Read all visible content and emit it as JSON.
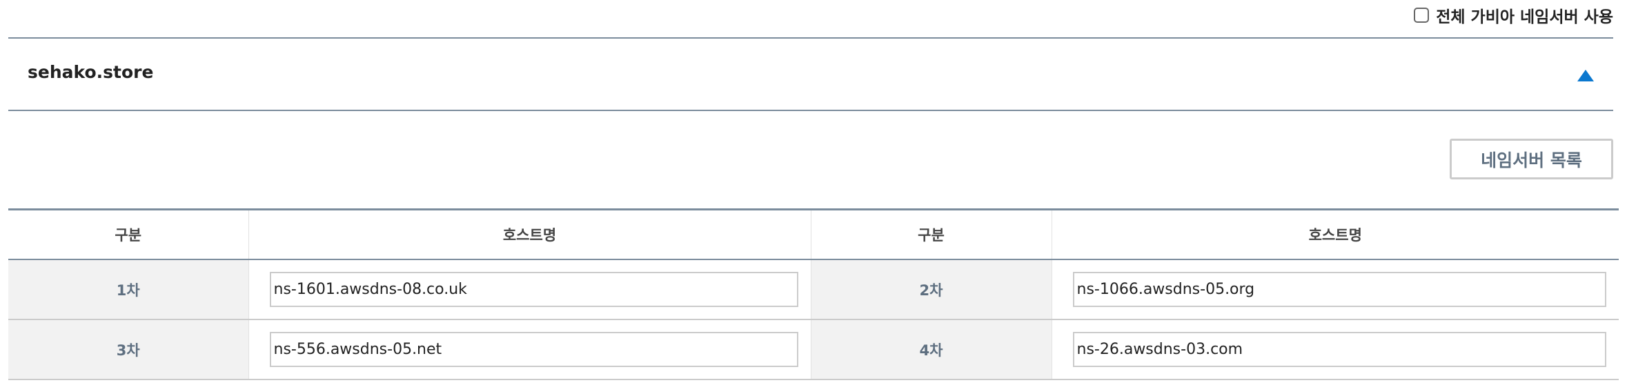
{
  "all_gabia_ns": {
    "label": "전체 가비아 네임서버 사용",
    "checked": false
  },
  "domain": {
    "name": "sehako.store",
    "expanded": true,
    "toggle_icon": "triangle-up-icon",
    "accent": "#0b78cf"
  },
  "ns_list_button": "네임서버 목록",
  "table": {
    "headers": [
      "구분",
      "호스트명",
      "구분",
      "호스트명"
    ],
    "rows": [
      [
        {
          "label": "1차",
          "host": "ns-1601.awsdns-08.co.uk"
        },
        {
          "label": "2차",
          "host": "ns-1066.awsdns-05.org"
        }
      ],
      [
        {
          "label": "3차",
          "host": "ns-556.awsdns-05.net"
        },
        {
          "label": "4차",
          "host": "ns-26.awsdns-03.com"
        }
      ]
    ]
  }
}
